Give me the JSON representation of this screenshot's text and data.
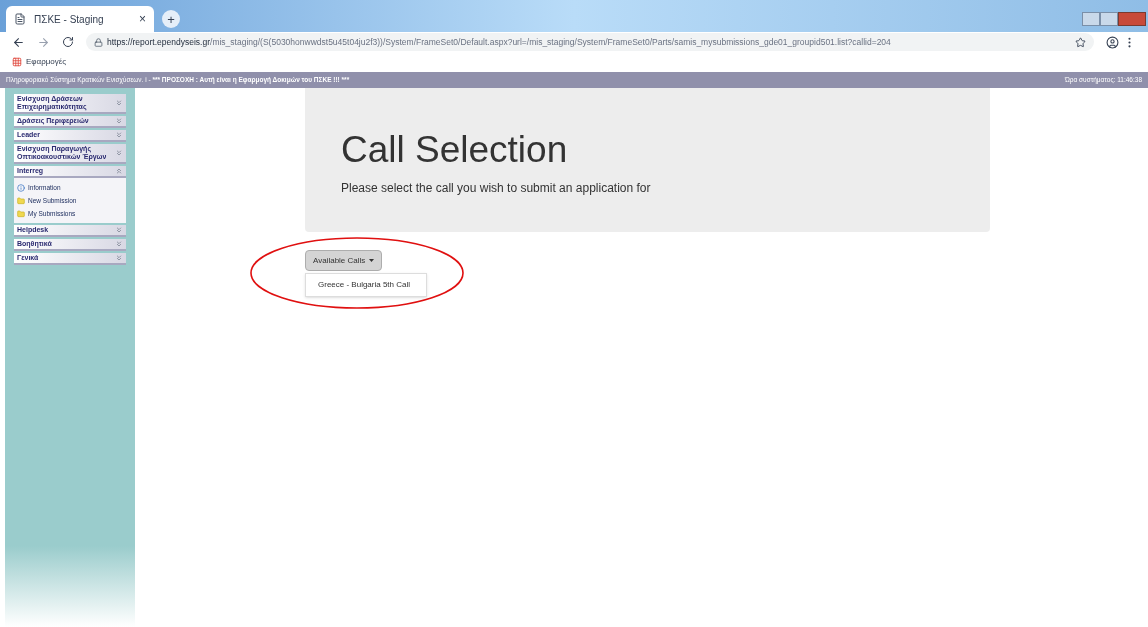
{
  "browser": {
    "tab": {
      "title": "ΠΣΚΕ - Staging",
      "close": "×"
    },
    "new_tab": "+",
    "url": {
      "host": "https://report.ependyseis.gr",
      "path": "/mis_staging/(S(5030honwwdst5u45t04ju2f3))/System/FrameSet0/Default.aspx?url=/mis_staging/System/FrameSet0/Parts/samis_mysubmissions_gde01_groupid501.list?callid=204"
    },
    "bookmarks": [
      {
        "label": "Εφαρμογές"
      }
    ]
  },
  "header": {
    "left": "Πληροφοριακό Σύστημα Κρατικών Ενισχύσεων. i - ",
    "warning": "*** ΠΡΟΣΟΧΗ : Αυτή είναι η Εφαρμογή Δοκιμών του ΠΣΚΕ !!! ***",
    "right": "Ώρα συστήματος: 11:46:38"
  },
  "sidebar": {
    "sections": [
      {
        "label": "Ενίσχυση Δράσεων Επιχειρηματικότητας",
        "expanded": false
      },
      {
        "label": "Δράσεις Περιφερειών",
        "expanded": false
      },
      {
        "label": "Leader",
        "expanded": false
      },
      {
        "label": "Ενίσχυση Παραγωγής Οπτικοακουστικών Έργων",
        "expanded": false
      },
      {
        "label": "Interreg",
        "expanded": true,
        "children": [
          {
            "label": "Information",
            "kind": "info"
          },
          {
            "label": "New Submission",
            "kind": "folder"
          },
          {
            "label": "My Submissions",
            "kind": "folder"
          }
        ]
      },
      {
        "label": "Helpdesk",
        "expanded": false
      },
      {
        "label": "Βοηθητικά",
        "expanded": false
      },
      {
        "label": "Γενικά",
        "expanded": false
      }
    ]
  },
  "main": {
    "title": "Call Selection",
    "subtitle": "Please select the call you wish to submit an application for",
    "dropdown": {
      "label": "Available Calls",
      "expanded": true,
      "options": [
        "Greece - Bulgaria 5th Call"
      ]
    }
  }
}
